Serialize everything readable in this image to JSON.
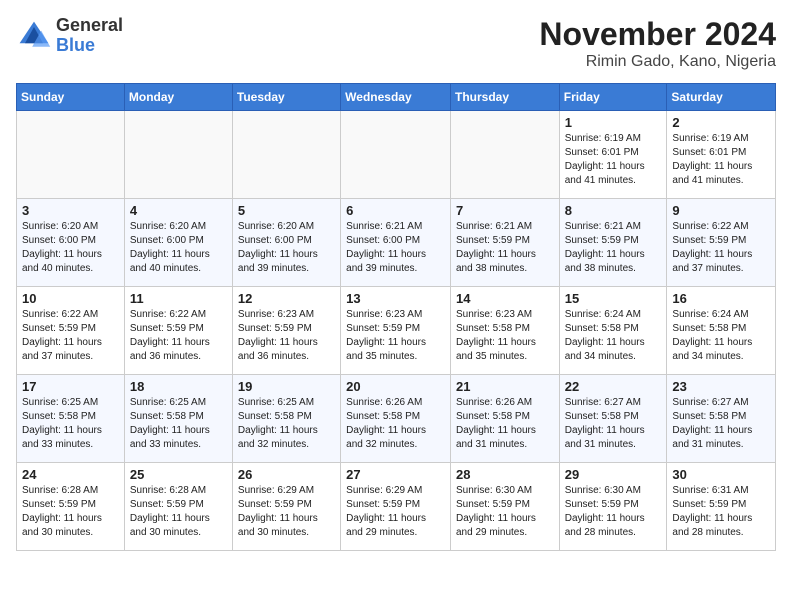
{
  "logo": {
    "general": "General",
    "blue": "Blue"
  },
  "title": "November 2024",
  "location": "Rimin Gado, Kano, Nigeria",
  "weekdays": [
    "Sunday",
    "Monday",
    "Tuesday",
    "Wednesday",
    "Thursday",
    "Friday",
    "Saturday"
  ],
  "weeks": [
    [
      {
        "day": "",
        "info": ""
      },
      {
        "day": "",
        "info": ""
      },
      {
        "day": "",
        "info": ""
      },
      {
        "day": "",
        "info": ""
      },
      {
        "day": "",
        "info": ""
      },
      {
        "day": "1",
        "info": "Sunrise: 6:19 AM\nSunset: 6:01 PM\nDaylight: 11 hours\nand 41 minutes."
      },
      {
        "day": "2",
        "info": "Sunrise: 6:19 AM\nSunset: 6:01 PM\nDaylight: 11 hours\nand 41 minutes."
      }
    ],
    [
      {
        "day": "3",
        "info": "Sunrise: 6:20 AM\nSunset: 6:00 PM\nDaylight: 11 hours\nand 40 minutes."
      },
      {
        "day": "4",
        "info": "Sunrise: 6:20 AM\nSunset: 6:00 PM\nDaylight: 11 hours\nand 40 minutes."
      },
      {
        "day": "5",
        "info": "Sunrise: 6:20 AM\nSunset: 6:00 PM\nDaylight: 11 hours\nand 39 minutes."
      },
      {
        "day": "6",
        "info": "Sunrise: 6:21 AM\nSunset: 6:00 PM\nDaylight: 11 hours\nand 39 minutes."
      },
      {
        "day": "7",
        "info": "Sunrise: 6:21 AM\nSunset: 5:59 PM\nDaylight: 11 hours\nand 38 minutes."
      },
      {
        "day": "8",
        "info": "Sunrise: 6:21 AM\nSunset: 5:59 PM\nDaylight: 11 hours\nand 38 minutes."
      },
      {
        "day": "9",
        "info": "Sunrise: 6:22 AM\nSunset: 5:59 PM\nDaylight: 11 hours\nand 37 minutes."
      }
    ],
    [
      {
        "day": "10",
        "info": "Sunrise: 6:22 AM\nSunset: 5:59 PM\nDaylight: 11 hours\nand 37 minutes."
      },
      {
        "day": "11",
        "info": "Sunrise: 6:22 AM\nSunset: 5:59 PM\nDaylight: 11 hours\nand 36 minutes."
      },
      {
        "day": "12",
        "info": "Sunrise: 6:23 AM\nSunset: 5:59 PM\nDaylight: 11 hours\nand 36 minutes."
      },
      {
        "day": "13",
        "info": "Sunrise: 6:23 AM\nSunset: 5:59 PM\nDaylight: 11 hours\nand 35 minutes."
      },
      {
        "day": "14",
        "info": "Sunrise: 6:23 AM\nSunset: 5:58 PM\nDaylight: 11 hours\nand 35 minutes."
      },
      {
        "day": "15",
        "info": "Sunrise: 6:24 AM\nSunset: 5:58 PM\nDaylight: 11 hours\nand 34 minutes."
      },
      {
        "day": "16",
        "info": "Sunrise: 6:24 AM\nSunset: 5:58 PM\nDaylight: 11 hours\nand 34 minutes."
      }
    ],
    [
      {
        "day": "17",
        "info": "Sunrise: 6:25 AM\nSunset: 5:58 PM\nDaylight: 11 hours\nand 33 minutes."
      },
      {
        "day": "18",
        "info": "Sunrise: 6:25 AM\nSunset: 5:58 PM\nDaylight: 11 hours\nand 33 minutes."
      },
      {
        "day": "19",
        "info": "Sunrise: 6:25 AM\nSunset: 5:58 PM\nDaylight: 11 hours\nand 32 minutes."
      },
      {
        "day": "20",
        "info": "Sunrise: 6:26 AM\nSunset: 5:58 PM\nDaylight: 11 hours\nand 32 minutes."
      },
      {
        "day": "21",
        "info": "Sunrise: 6:26 AM\nSunset: 5:58 PM\nDaylight: 11 hours\nand 31 minutes."
      },
      {
        "day": "22",
        "info": "Sunrise: 6:27 AM\nSunset: 5:58 PM\nDaylight: 11 hours\nand 31 minutes."
      },
      {
        "day": "23",
        "info": "Sunrise: 6:27 AM\nSunset: 5:58 PM\nDaylight: 11 hours\nand 31 minutes."
      }
    ],
    [
      {
        "day": "24",
        "info": "Sunrise: 6:28 AM\nSunset: 5:59 PM\nDaylight: 11 hours\nand 30 minutes."
      },
      {
        "day": "25",
        "info": "Sunrise: 6:28 AM\nSunset: 5:59 PM\nDaylight: 11 hours\nand 30 minutes."
      },
      {
        "day": "26",
        "info": "Sunrise: 6:29 AM\nSunset: 5:59 PM\nDaylight: 11 hours\nand 30 minutes."
      },
      {
        "day": "27",
        "info": "Sunrise: 6:29 AM\nSunset: 5:59 PM\nDaylight: 11 hours\nand 29 minutes."
      },
      {
        "day": "28",
        "info": "Sunrise: 6:30 AM\nSunset: 5:59 PM\nDaylight: 11 hours\nand 29 minutes."
      },
      {
        "day": "29",
        "info": "Sunrise: 6:30 AM\nSunset: 5:59 PM\nDaylight: 11 hours\nand 28 minutes."
      },
      {
        "day": "30",
        "info": "Sunrise: 6:31 AM\nSunset: 5:59 PM\nDaylight: 11 hours\nand 28 minutes."
      }
    ]
  ]
}
